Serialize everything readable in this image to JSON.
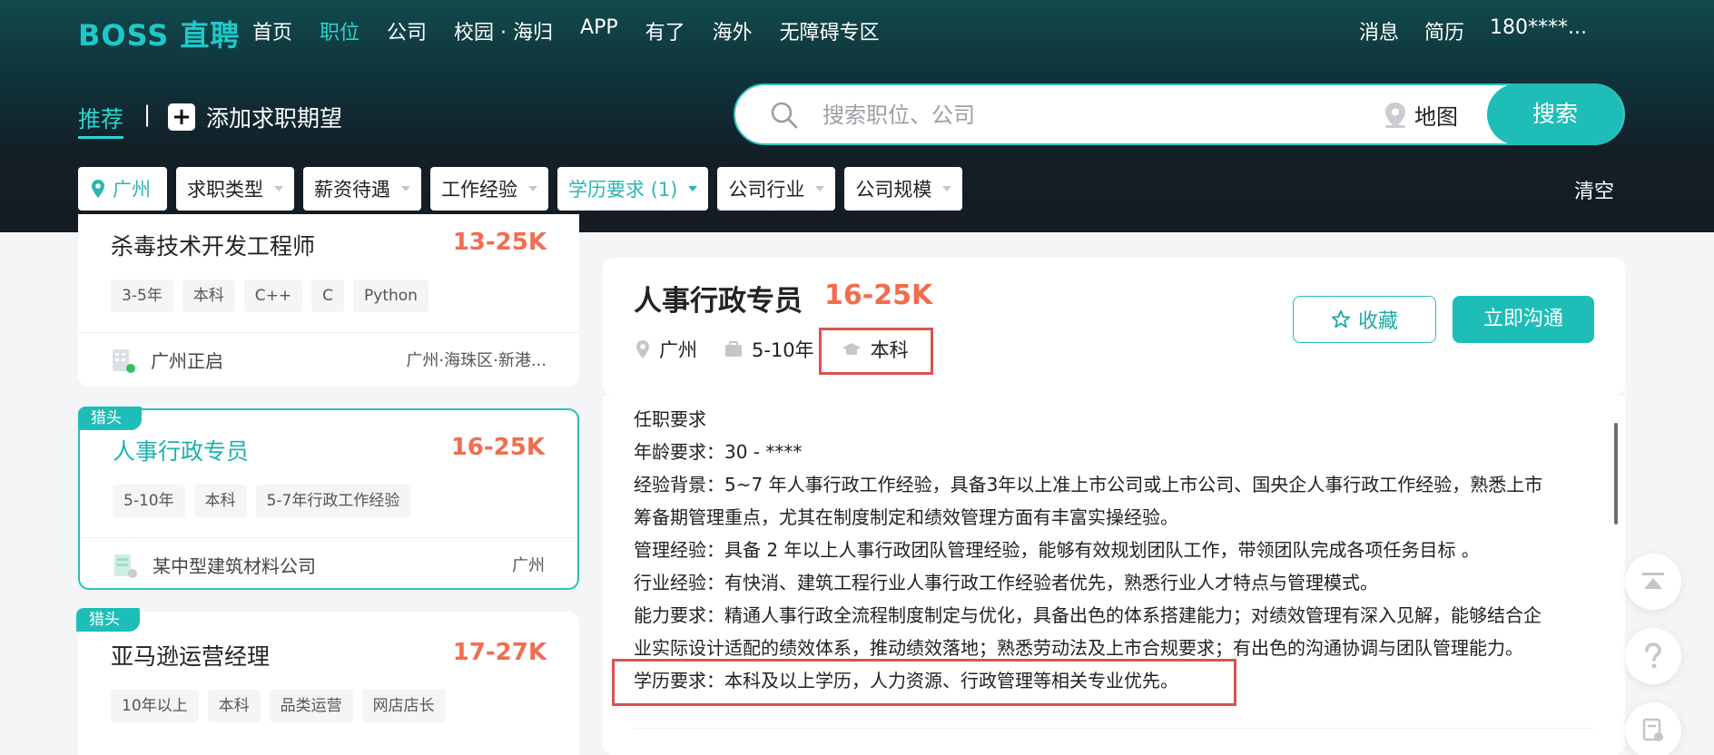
{
  "header": {
    "logo": "BOSS 直聘",
    "nav": [
      "首页",
      "职位",
      "公司",
      "校园 · 海归",
      "APP",
      "有了",
      "海外",
      "无障碍专区"
    ],
    "nav_active": "职位",
    "user_nav": {
      "messages": "消息",
      "resume": "简历",
      "phone": "180****..."
    }
  },
  "subbar": {
    "recommend": "推荐",
    "separator": "|",
    "add_expectation": "添加求职期望",
    "search_placeholder": "搜索职位、公司",
    "map": "地图",
    "search_button": "搜索"
  },
  "filters": [
    {
      "label": "广州",
      "active": true,
      "kind": "city"
    },
    {
      "label": "求职类型",
      "active": false
    },
    {
      "label": "薪资待遇",
      "active": false
    },
    {
      "label": "工作经验",
      "active": false
    },
    {
      "label": "学历要求 (1)",
      "active": true
    },
    {
      "label": "公司行业",
      "active": false
    },
    {
      "label": "公司规模",
      "active": false
    }
  ],
  "clear": "清空",
  "job_list": [
    {
      "title": "杀毒技术开发工程师",
      "salary": "13-25K",
      "tags": [
        "3-5年",
        "本科",
        "C++",
        "C",
        "Python"
      ],
      "company": "广州正启",
      "location": "广州·海珠区·新港..."
    },
    {
      "badge": "猎头",
      "title": "人事行政专员",
      "salary": "16-25K",
      "tags": [
        "5-10年",
        "本科",
        "5-7年行政工作经验"
      ],
      "company": "某中型建筑材料公司",
      "location": "广州"
    },
    {
      "badge": "猎头",
      "title": "亚马逊运营经理",
      "salary": "17-27K",
      "tags": [
        "10年以上",
        "本科",
        "品类运营",
        "网店店长"
      ]
    }
  ],
  "detail": {
    "title": "人事行政专员",
    "salary": "16-25K",
    "city": "广州",
    "experience": "5-10年",
    "education": "本科",
    "favorite": "收藏",
    "chat": "立即沟通",
    "description": [
      "任职要求",
      "年龄要求：30 - ****",
      "经验背景：5~7 年人事行政工作经验，具备3年以上准上市公司或上市公司、国央企人事行政工作经验，熟悉上市",
      "筹备期管理重点，尤其在制度制定和绩效管理方面有丰富实操经验。",
      "管理经验：具备 2 年以上人事行政团队管理经验，能够有效规划团队工作，带领团队完成各项任务目标 。",
      "行业经验：有快消、建筑工程行业人事行政工作经验者优先，熟悉行业人才特点与管理模式。",
      "能力要求：精通人事行政全流程制度制定与优化，具备出色的体系搭建能力；对绩效管理有深入见解，能够结合企",
      "业实际设计适配的绩效体系，推动绩效落地；熟悉劳动法及上市合规要求；有出色的沟通协调与团队管理能力。",
      "学历要求：本科及以上学历，人力资源、行政管理等相关专业优先。"
    ]
  },
  "colors": {
    "accent": "#1fbdb7",
    "salary": "#f26d50",
    "highlight": "#d9534f"
  },
  "icons": [
    "search-icon",
    "location-icon",
    "plus-icon",
    "briefcase-icon",
    "graduation-cap-icon",
    "star-icon",
    "back-to-top-icon",
    "help-icon",
    "feedback-icon"
  ]
}
